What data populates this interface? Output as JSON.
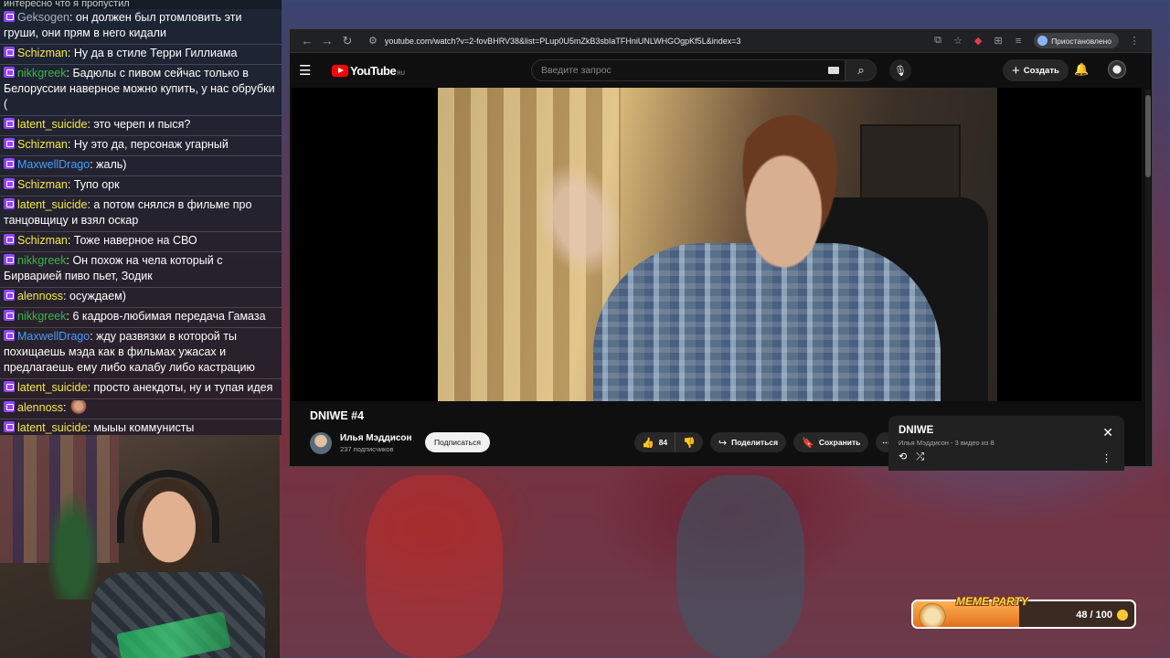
{
  "chat": {
    "top_fragment": "интересно что я пропустил",
    "messages": [
      {
        "user": "Geksogen",
        "color": "gray",
        "text": ": он должен был ртомловить эти груши, они прям в него кидали"
      },
      {
        "user": "Schizman",
        "color": "yellow",
        "text": ": Ну да в стиле Терри Гиллиама"
      },
      {
        "user": "nikkgreek",
        "color": "green",
        "text": ": Бадюлы с пивом сейчас только в Белоруссии наверное можно купить, у нас обрубки ("
      },
      {
        "user": "latent_suicide",
        "color": "yellow",
        "text": ": это череп и пыся?"
      },
      {
        "user": "Schizman",
        "color": "yellow",
        "text": ": Ну это да, персонаж угарный"
      },
      {
        "user": "MaxwellDrago",
        "color": "blue",
        "text": ": жаль)"
      },
      {
        "user": "Schizman",
        "color": "yellow",
        "text": ": Тупо орк"
      },
      {
        "user": "latent_suicide",
        "color": "yellow",
        "text": ": а потом снялся в фильме про танцовщицу и взял оскар"
      },
      {
        "user": "Schizman",
        "color": "yellow",
        "text": ": Тоже наверное на СВО"
      },
      {
        "user": "nikkgreek",
        "color": "green",
        "text": ": Он похож на чела который с Бирварией пиво пьет, Зодик"
      },
      {
        "user": "alennoss",
        "color": "yellow",
        "text": ": осуждаем)"
      },
      {
        "user": "nikkgreek",
        "color": "green",
        "text": ": 6 кадров-любимая передача Гамаза"
      },
      {
        "user": "MaxwellDrago",
        "color": "blue",
        "text": ": жду развязки в которой ты похищаешь мэда как в фильмах ужасах и предлагаешь ему либо калабу либо кастрацию"
      },
      {
        "user": "latent_suicide",
        "color": "yellow",
        "text": ": просто анекдоты, ну и тупая идея"
      },
      {
        "user": "alennoss",
        "color": "yellow",
        "text": ":",
        "emote": "face-emote"
      },
      {
        "user": "latent_suicide",
        "color": "yellow",
        "text": ": мыыы коммунисты"
      }
    ]
  },
  "browser": {
    "url": "youtube.com/watch?v=2-fovBHRV38&list=PLup0U5mZkB3sbIaTFHniUNLWHGOgpKf5L&index=3",
    "profile_label": "Приостановлено",
    "nav_back": "←",
    "nav_forward": "→",
    "nav_reload": "↻"
  },
  "youtube": {
    "logo_word": "YouTube",
    "logo_region": "RU",
    "search_placeholder": "Введите запрос",
    "create_label": "Создать",
    "video_title": "DNIWE #4",
    "channel_name": "Илья Мэддисон",
    "channel_subs": "237 подписчиков",
    "subscribe_label": "Подписаться",
    "likes": "84",
    "share_label": "Поделиться",
    "save_label": "Сохранить",
    "playlist_title": "DNIWE",
    "playlist_sub": "Илья Мэддисон - 3 видео из 8"
  },
  "widget": {
    "title": "MEME PARTY",
    "count_text": "48 / 100",
    "progress": 0.48,
    "accent": "#f08a30"
  }
}
